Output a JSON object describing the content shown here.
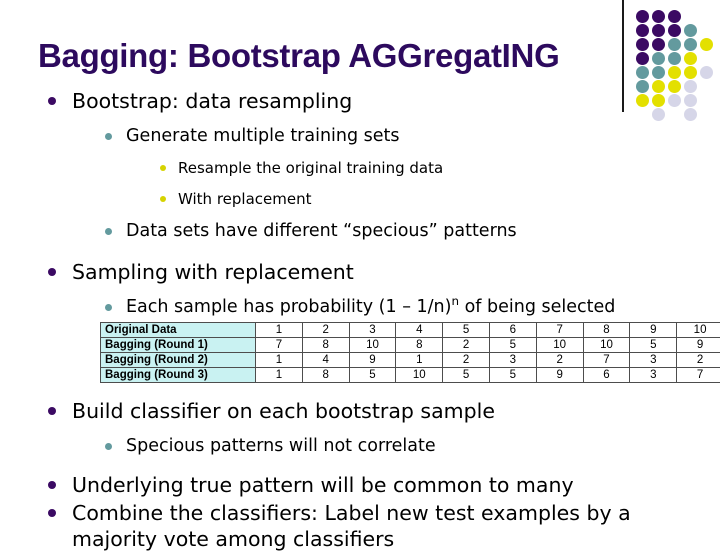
{
  "slide": {
    "title": "Bagging: Bootstrap AGGregatING",
    "title_color": "#2d0a5e",
    "background": "#ffffff"
  },
  "decoration": {
    "name": "dot-grid-decoration",
    "rule_color": "#1a1a1a",
    "colors": {
      "purple": "#3b0a63",
      "teal": "#639a9e",
      "yellow": "#e3e000",
      "lavender": "#d6d6e8"
    },
    "grid": [
      [
        "purple",
        "purple",
        "purple",
        null,
        null
      ],
      [
        "purple",
        "purple",
        "purple",
        "teal",
        null
      ],
      [
        "purple",
        "purple",
        "teal",
        "teal",
        "yellow"
      ],
      [
        "purple",
        "teal",
        "teal",
        "yellow",
        null
      ],
      [
        "teal",
        "teal",
        "yellow",
        "yellow",
        "lavender"
      ],
      [
        "teal",
        "yellow",
        "yellow",
        "lavender",
        null
      ],
      [
        "yellow",
        "yellow",
        "lavender",
        "lavender",
        null
      ],
      [
        null,
        "lavender",
        null,
        "lavender",
        null
      ]
    ]
  },
  "bullets": {
    "b1": "Bootstrap: data resampling",
    "b1_1": "Generate multiple training sets",
    "b1_1_1": "Resample the original training data",
    "b1_1_2": "With replacement",
    "b1_2": "Data sets have different “specious” patterns",
    "b2": "Sampling with replacement",
    "b2_1_pre": "Each sample has probability (1 – 1/n)",
    "b2_1_sup": "n",
    "b2_1_post": " of being selected",
    "b3": "Build classifier on each bootstrap sample",
    "b3_1": "Specious patterns will not correlate",
    "b4": "Underlying true pattern will be common to many",
    "b5": "Combine the classifiers: Label new test examples by a majority vote among classifiers"
  },
  "table": {
    "label_bg": "#c9f2f2",
    "rows": [
      {
        "label": "Original Data",
        "values": [
          "1",
          "2",
          "3",
          "4",
          "5",
          "6",
          "7",
          "8",
          "9",
          "10"
        ]
      },
      {
        "label": "Bagging (Round 1)",
        "values": [
          "7",
          "8",
          "10",
          "8",
          "2",
          "5",
          "10",
          "10",
          "5",
          "9"
        ]
      },
      {
        "label": "Bagging (Round 2)",
        "values": [
          "1",
          "4",
          "9",
          "1",
          "2",
          "3",
          "2",
          "7",
          "3",
          "2"
        ]
      },
      {
        "label": "Bagging (Round 3)",
        "values": [
          "1",
          "8",
          "5",
          "10",
          "5",
          "5",
          "9",
          "6",
          "3",
          "7"
        ]
      }
    ]
  }
}
